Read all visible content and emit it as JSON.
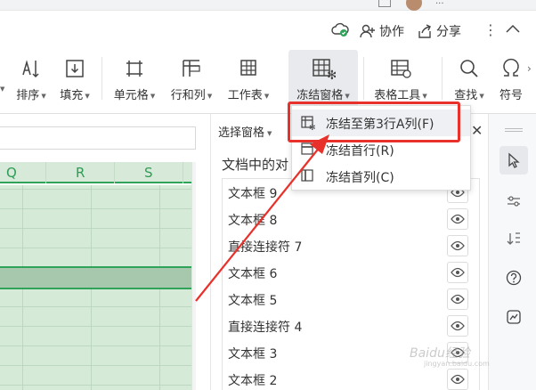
{
  "titlebar": {
    "collab_label": "协作",
    "share_label": "分享"
  },
  "ribbon": {
    "items": [
      {
        "label": "排序",
        "icon": "sort-icon"
      },
      {
        "label": "填充",
        "icon": "fill-icon"
      },
      {
        "label": "单元格",
        "icon": "cell-icon"
      },
      {
        "label": "行和列",
        "icon": "rows-cols-icon"
      },
      {
        "label": "工作表",
        "icon": "worksheet-icon"
      },
      {
        "label": "冻结窗格",
        "icon": "freeze-panes-icon"
      },
      {
        "label": "表格工具",
        "icon": "table-tools-icon"
      },
      {
        "label": "查找",
        "icon": "find-icon"
      },
      {
        "label": "符号",
        "icon": "symbol-icon"
      }
    ]
  },
  "sheet": {
    "columns": [
      "Q",
      "R",
      "S"
    ]
  },
  "selection_panel": {
    "header": "选择窗格",
    "title": "文档中的对",
    "objects": [
      "文本框 9",
      "文本框 8",
      "直接连接符 7",
      "文本框 6",
      "文本框 5",
      "直接连接符 4",
      "文本框 3",
      "文本框 2"
    ]
  },
  "freeze_menu": {
    "items": [
      {
        "label": "冻结至第3行A列(F)"
      },
      {
        "label": "冻结首行(R)"
      },
      {
        "label": "冻结首列(C)"
      }
    ]
  },
  "colors": {
    "accent_green": "#2ea359",
    "highlight_red": "#e8312a"
  },
  "watermark": {
    "text": "Baidu经验",
    "sub": "jingyan.baidu.com"
  }
}
